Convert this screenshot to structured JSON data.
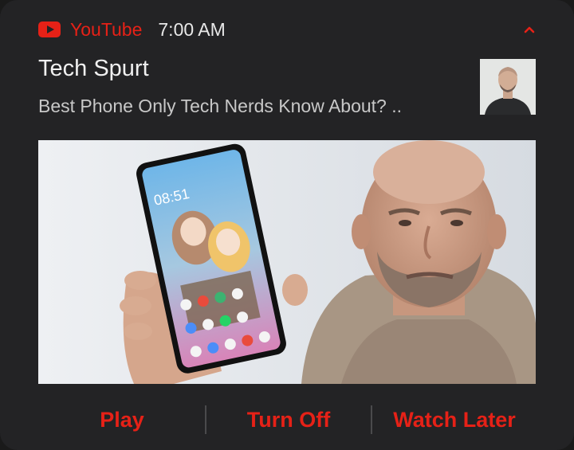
{
  "notification": {
    "app_name": "YouTube",
    "time": "7:00 AM",
    "channel": "Tech Spurt",
    "video_title": "Best Phone Only Tech Nerds Know About? ..",
    "accent_color": "#e62117",
    "icons": {
      "app": "youtube-logo-icon",
      "expand": "chevron-up-icon"
    },
    "phone_clock": "08:51"
  },
  "actions": [
    {
      "label": "Play"
    },
    {
      "label": "Turn Off"
    },
    {
      "label": "Watch Later"
    }
  ]
}
